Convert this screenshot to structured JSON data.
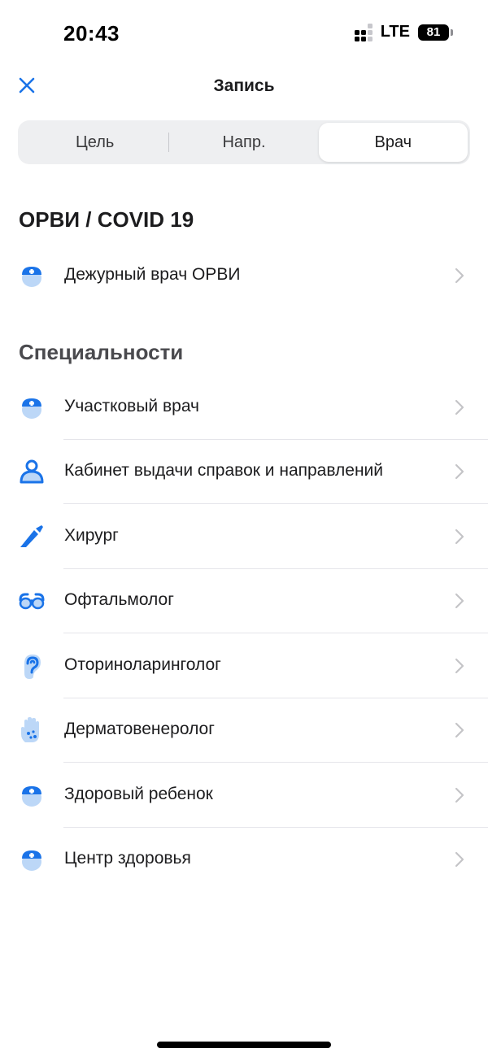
{
  "status_bar": {
    "time": "20:43",
    "network": "LTE",
    "battery": "81"
  },
  "nav": {
    "title": "Запись"
  },
  "tabs": [
    {
      "label": "Цель"
    },
    {
      "label": "Напр."
    },
    {
      "label": "Врач"
    }
  ],
  "active_tab": "Врач",
  "sections": {
    "covid": {
      "title": "ОРВИ / COVID 19",
      "items": [
        {
          "label": "Дежурный врач ОРВИ",
          "icon": "doctor-icon"
        }
      ]
    },
    "specialties": {
      "title": "Специальности",
      "items": [
        {
          "label": "Участковый врач",
          "icon": "doctor-icon"
        },
        {
          "label": "Кабинет выдачи справок и направлений",
          "icon": "reception-icon"
        },
        {
          "label": "Хирург",
          "icon": "scalpel-icon"
        },
        {
          "label": "Офтальмолог",
          "icon": "glasses-icon"
        },
        {
          "label": "Оториноларинголог",
          "icon": "ear-icon"
        },
        {
          "label": "Дерматовенеролог",
          "icon": "hand-icon"
        },
        {
          "label": "Здоровый ребенок",
          "icon": "doctor-icon"
        },
        {
          "label": "Центр здоровья",
          "icon": "doctor-icon"
        }
      ]
    }
  },
  "colors": {
    "accent": "#1a73e8",
    "icon_light": "#bcd7f7",
    "chevron": "#c4c4c7",
    "divider": "#e5e5ea"
  }
}
